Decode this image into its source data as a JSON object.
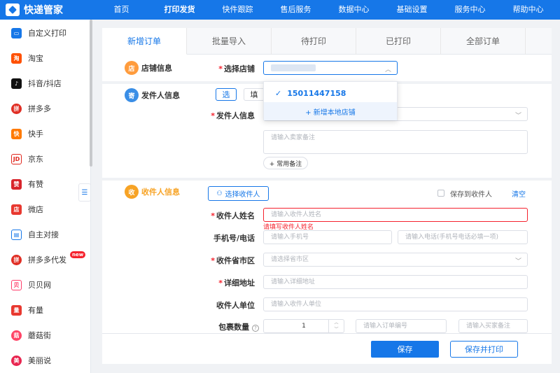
{
  "app": {
    "title": "快递管家"
  },
  "nav": [
    "首页",
    "打印发货",
    "快件跟踪",
    "售后服务",
    "数据中心",
    "基础设置",
    "服务中心",
    "帮助中心"
  ],
  "sidebar": {
    "items": [
      {
        "label": "自定义打印",
        "icon": "custom-print-icon",
        "color": "#1677e8"
      },
      {
        "label": "淘宝",
        "icon": "taobao-icon",
        "color": "#ff5000"
      },
      {
        "label": "抖音/抖店",
        "icon": "douyin-icon",
        "color": "#111111"
      },
      {
        "label": "拼多多",
        "icon": "pinduoduo-icon",
        "color": "#e02e24"
      },
      {
        "label": "快手",
        "icon": "kuaishou-icon",
        "color": "#ff7a00"
      },
      {
        "label": "京东",
        "icon": "jd-icon",
        "color": "#e1251b"
      },
      {
        "label": "有赞",
        "icon": "youzan-icon",
        "color": "#d8252c"
      },
      {
        "label": "微店",
        "icon": "weidian-icon",
        "color": "#e8382f"
      },
      {
        "label": "自主对接",
        "icon": "self-connect-icon",
        "color": "#1677e8"
      },
      {
        "label": "拼多多代发",
        "icon": "pinduoduo-daifa-icon",
        "color": "#e02e24",
        "badge": "new"
      },
      {
        "label": "贝贝网",
        "icon": "beibei-icon",
        "color": "#ff3d6a"
      },
      {
        "label": "有量",
        "icon": "youliang-icon",
        "color": "#e8382f"
      },
      {
        "label": "蘑菇街",
        "icon": "mogujie-icon",
        "color": "#ff4466"
      },
      {
        "label": "美丽说",
        "icon": "meilishuo-icon",
        "color": "#e8254f"
      }
    ]
  },
  "tabs": [
    "新增订单",
    "批量导入",
    "待打印",
    "已打印",
    "全部订单"
  ],
  "shop": {
    "badge": "店",
    "title": "店铺信息",
    "select_label": "选择店铺",
    "dropdown": {
      "option": "15011447158",
      "add": "+ 新增本地店铺"
    }
  },
  "sender": {
    "badge": "寄",
    "title": "发件人信息",
    "select_btn": "选",
    "fill_btn": "填",
    "field_label": "发件人信息",
    "remark_placeholder": "请输入卖家备注",
    "common_remark": "+ 常用备注"
  },
  "receiver": {
    "badge": "收",
    "title": "收件人信息",
    "select_btn": "选择收件人",
    "save_label": "保存到收件人",
    "clear": "清空",
    "name_label": "收件人姓名",
    "name_placeholder": "请输入收件人姓名",
    "name_error": "请填写收件人姓名",
    "phone_label": "手机号/电话",
    "mobile_placeholder": "请输入手机号",
    "tel_placeholder": "请输入电话(手机号电话必填一项)",
    "region_label": "收件省市区",
    "region_placeholder": "请选择省市区",
    "address_label": "详细地址",
    "address_placeholder": "请输入详细地址",
    "company_label": "收件人单位",
    "company_placeholder": "请输入收件人单位",
    "package_label": "包裹数量",
    "package_value": "1",
    "order_no_placeholder": "请输入订单编号",
    "buyer_remark_placeholder": "请输入买家备注"
  },
  "footer": {
    "save": "保存",
    "save_print": "保存并打印"
  },
  "colors": {
    "primary": "#1677e8",
    "error": "#f5222d",
    "shop_badge": "#ff9c3d",
    "sender_badge": "#3a8ee6",
    "receiver_badge": "#f7a325"
  }
}
